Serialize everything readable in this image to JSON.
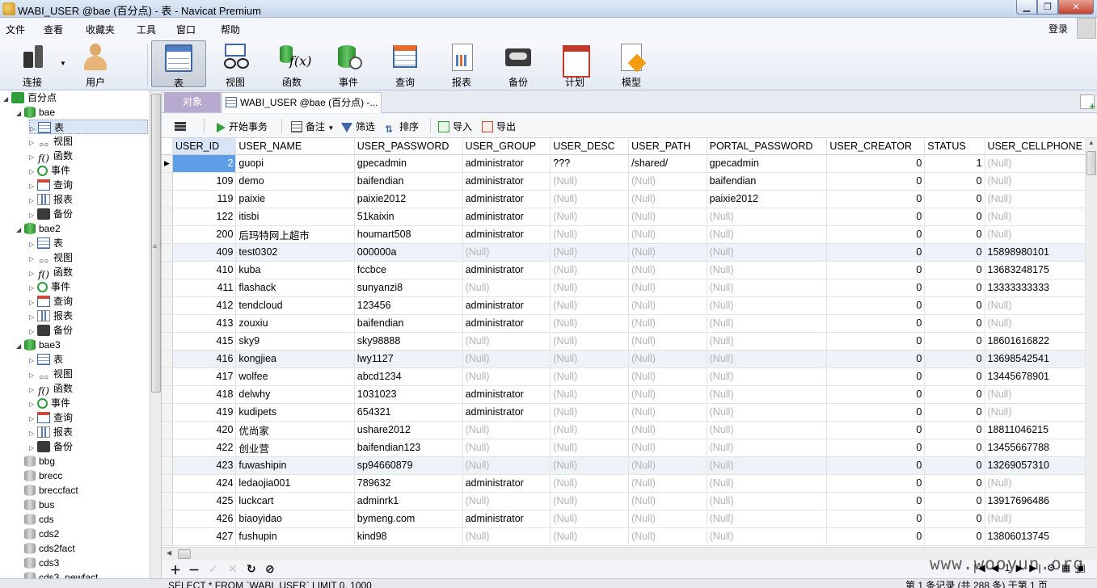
{
  "window": {
    "title": "WABI_USER @bae (百分点) - 表 - Navicat Premium"
  },
  "menu": {
    "items": [
      "文件",
      "查看",
      "收藏夹",
      "工具",
      "窗口",
      "帮助"
    ],
    "login": "登录"
  },
  "toolbar": {
    "items": [
      {
        "label": "连接",
        "icon": "plug-icon"
      },
      {
        "label": "用户",
        "icon": "user-icon"
      },
      {
        "label": "表",
        "icon": "table-icon"
      },
      {
        "label": "视图",
        "icon": "view-icon"
      },
      {
        "label": "函数",
        "icon": "function-icon"
      },
      {
        "label": "事件",
        "icon": "event-icon"
      },
      {
        "label": "查询",
        "icon": "query-icon"
      },
      {
        "label": "报表",
        "icon": "report-icon"
      },
      {
        "label": "备份",
        "icon": "backup-icon"
      },
      {
        "label": "计划",
        "icon": "schedule-icon"
      },
      {
        "label": "模型",
        "icon": "model-icon"
      }
    ]
  },
  "tree": {
    "connection": "百分点",
    "object_labels": {
      "table": "表",
      "view": "视图",
      "function": "函数",
      "event": "事件",
      "query": "查询",
      "report": "报表",
      "backup": "备份"
    },
    "open_databases": [
      "bae",
      "bae2",
      "bae3"
    ],
    "other_databases": [
      "bbg",
      "brecc",
      "breccfact",
      "bus",
      "cds",
      "cds2",
      "cds2fact",
      "cds3",
      "cds3_newfact"
    ]
  },
  "tabs": {
    "objects": "对象",
    "table_tab": "WABI_USER @bae (百分点) -..."
  },
  "grid_toolbar": {
    "begin_tx": "开始事务",
    "note": "备注",
    "filter": "筛选",
    "sort": "排序",
    "import": "导入",
    "export": "导出"
  },
  "grid": {
    "columns": [
      "USER_ID",
      "USER_NAME",
      "USER_PASSWORD",
      "USER_GROUP",
      "USER_DESC",
      "USER_PATH",
      "PORTAL_PASSWORD",
      "USER_CREATOR",
      "STATUS",
      "USER_CELLPHONE"
    ],
    "null_text": "(Null)",
    "rows": [
      [
        "2",
        "guopi",
        "gpecadmin",
        "administrator",
        "???",
        "/shared/",
        "gpecadmin",
        "0",
        "1",
        null
      ],
      [
        "109",
        "demo",
        "baifendian",
        "administrator",
        null,
        null,
        "baifendian",
        "0",
        "0",
        null
      ],
      [
        "119",
        "paixie",
        "paixie2012",
        "administrator",
        null,
        null,
        "paixie2012",
        "0",
        "0",
        null
      ],
      [
        "122",
        "itisbi",
        "51kaixin",
        "administrator",
        null,
        null,
        null,
        "0",
        "0",
        null
      ],
      [
        "200",
        "后玛特网上超市",
        "houmart508",
        "administrator",
        null,
        null,
        null,
        "0",
        "0",
        null
      ],
      [
        "409",
        "test0302",
        "000000a",
        null,
        null,
        null,
        null,
        "0",
        "0",
        "15898980101"
      ],
      [
        "410",
        "kuba",
        "fccbce",
        "administrator",
        null,
        null,
        null,
        "0",
        "0",
        "13683248175"
      ],
      [
        "411",
        "flashack",
        "sunyanzi8",
        null,
        null,
        null,
        null,
        "0",
        "0",
        "13333333333"
      ],
      [
        "412",
        "tendcloud",
        "123456",
        "administrator",
        null,
        null,
        null,
        "0",
        "0",
        null
      ],
      [
        "413",
        "zouxiu",
        "baifendian",
        "administrator",
        null,
        null,
        null,
        "0",
        "0",
        null
      ],
      [
        "415",
        "sky9",
        "sky98888",
        null,
        null,
        null,
        null,
        "0",
        "0",
        "18601616822"
      ],
      [
        "416",
        "kongjiea",
        "lwy1127",
        null,
        null,
        null,
        null,
        "0",
        "0",
        "13698542541"
      ],
      [
        "417",
        "wolfee",
        "abcd1234",
        null,
        null,
        null,
        null,
        "0",
        "0",
        "13445678901"
      ],
      [
        "418",
        "delwhy",
        "1031023",
        "administrator",
        null,
        null,
        null,
        "0",
        "0",
        null
      ],
      [
        "419",
        "kudipets",
        "654321",
        "administrator",
        null,
        null,
        null,
        "0",
        "0",
        null
      ],
      [
        "420",
        "优尚家",
        "ushare2012",
        null,
        null,
        null,
        null,
        "0",
        "0",
        "18811046215"
      ],
      [
        "422",
        "创业营",
        "baifendian123",
        null,
        null,
        null,
        null,
        "0",
        "0",
        "13455667788"
      ],
      [
        "423",
        "fuwashipin",
        "sp94660879",
        null,
        null,
        null,
        null,
        "0",
        "0",
        "13269057310"
      ],
      [
        "424",
        "ledaojia001",
        "789632",
        "administrator",
        null,
        null,
        null,
        "0",
        "0",
        null
      ],
      [
        "425",
        "luckcart",
        "adminrk1",
        null,
        null,
        null,
        null,
        "0",
        "0",
        "13917696486"
      ],
      [
        "426",
        "biaoyidao",
        "bymeng.com",
        "administrator",
        null,
        null,
        null,
        "0",
        "0",
        null
      ],
      [
        "427",
        "fushupin",
        "kind98",
        null,
        null,
        null,
        null,
        "0",
        "0",
        "13806013745"
      ]
    ]
  },
  "bottom": {
    "page": "1",
    "pager_icons": "|◀ ◀ 1 ▶ ▶| ⚙ ▦ ▣"
  },
  "status": {
    "sql": "SELECT * FROM `WABI_USER` LIMIT 0, 1000",
    "count": "第 1 条记录 (共 288 条) 于第 1 页"
  },
  "watermark": "www.wooyun.org"
}
